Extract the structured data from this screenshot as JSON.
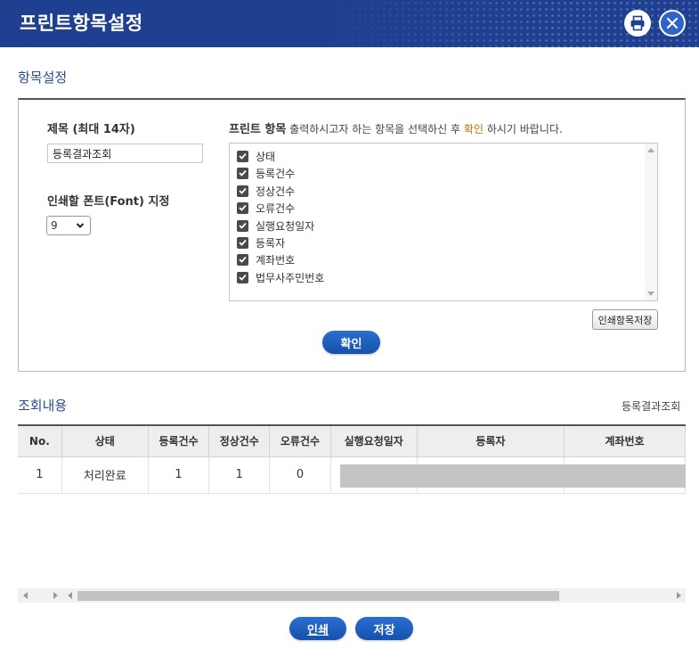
{
  "header": {
    "title": "프린트항목설정"
  },
  "settings": {
    "section_title": "항목설정",
    "title_label": "제목 (최대 14자)",
    "title_value": "등록결과조회",
    "font_label": "인쇄할 폰트(Font) 지정",
    "font_value": "9",
    "print_items_label": "프린트 항목",
    "print_items_desc_pre": "출력하시고자 하는 항목을 선택하신 후",
    "print_items_desc_accent": "확인",
    "print_items_desc_post": "하시기 바랍니다.",
    "items": [
      {
        "label": "상태",
        "checked": true
      },
      {
        "label": "등록건수",
        "checked": true
      },
      {
        "label": "정상건수",
        "checked": true
      },
      {
        "label": "오류건수",
        "checked": true
      },
      {
        "label": "실행요청일자",
        "checked": true
      },
      {
        "label": "등록자",
        "checked": true
      },
      {
        "label": "계좌번호",
        "checked": true
      },
      {
        "label": "법무사주민번호",
        "checked": true
      }
    ],
    "save_items_label": "인쇄항목저장",
    "confirm_label": "확인"
  },
  "results": {
    "section_title": "조회내용",
    "subtitle": "등록결과조회",
    "columns": [
      "No.",
      "상태",
      "등록건수",
      "정상건수",
      "오류건수",
      "실행요청일자",
      "등록자",
      "계좌번호"
    ],
    "rows": [
      [
        "1",
        "처리완료",
        "1",
        "1",
        "0",
        "",
        "",
        ""
      ]
    ]
  },
  "footer": {
    "print_label": "인쇄",
    "save_label": "저장"
  },
  "colors": {
    "header_bg": "#1f3f91",
    "button_blue": "#1a5cc0",
    "accent_orange": "#c86f00"
  }
}
